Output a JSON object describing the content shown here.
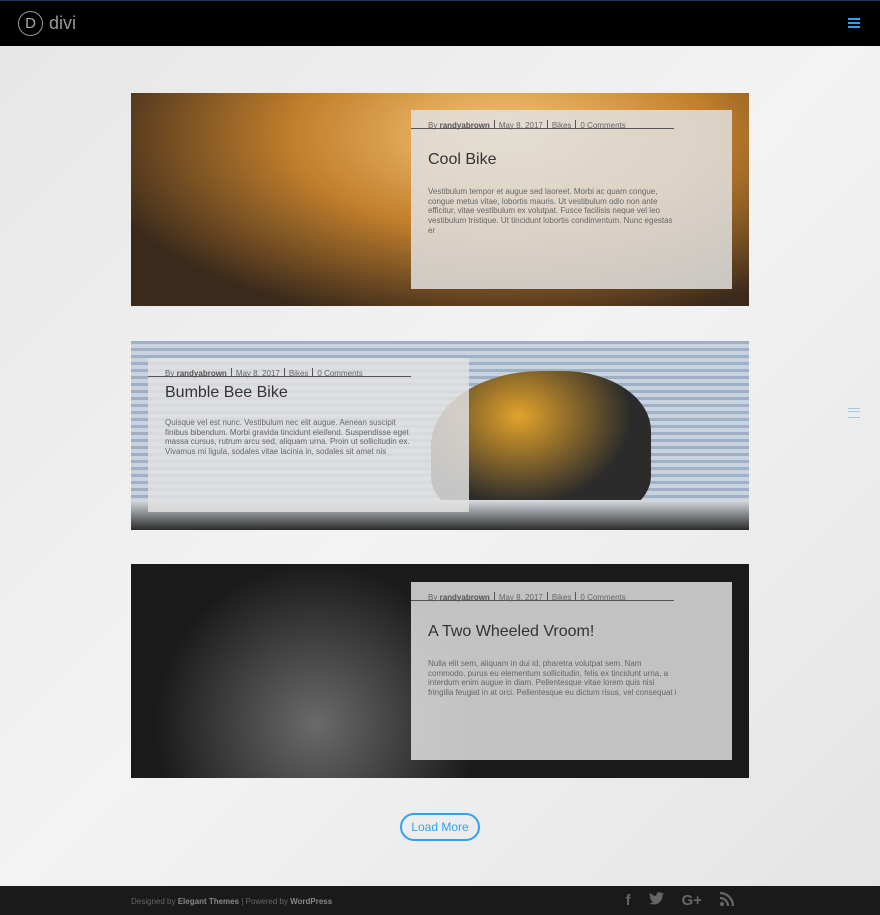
{
  "header": {
    "logo_letter": "D",
    "logo_text": "divi"
  },
  "posts": [
    {
      "by": "By",
      "author": "randyabrown",
      "date": "May 8, 2017",
      "category": "Bikes",
      "comments": "0 Comments",
      "title": "Cool Bike",
      "excerpt": "Vestibulum tempor et augue sed laoreet. Morbi ac quam congue, congue metus vitae, lobortis mauris. Ut vestibulum odio non ante efficitur, vitae vestibulum ex volutpat. Fusce facilisis neque vel leo vestibulum tristique. Ut tincidunt lobortis condimentum. Nunc egestas er"
    },
    {
      "by": "By",
      "author": "randyabrown",
      "date": "May 8, 2017",
      "category": "Bikes",
      "comments": "0 Comments",
      "title": "Bumble Bee Bike",
      "excerpt": "Quisque vel est nunc. Vestibulum nec elit augue. Aenean suscipit finibus bibendum. Morbi gravida tincidunt eleifend. Suspendisse eget massa cursus, rutrum arcu sed, aliquam urna. Proin ut sollicitudin ex. Vivamus mi ligula, sodales vitae lacinia in, sodales sit amet nis"
    },
    {
      "by": "By",
      "author": "randyabrown",
      "date": "May 8, 2017",
      "category": "Bikes",
      "comments": "0 Comments",
      "title": "A Two Wheeled Vroom!",
      "excerpt": "Nulla elit sem, aliquam in dui id, pharetra volutpat sem. Nam commodo, purus eu elementum sollicitudin, felis ex tincidunt urna, a interdum enim augue in diam. Pellentesque vitae lorem quis nisi fringilla feugiat in at orci. Pellentesque eu dictum risus, vel consequat i"
    }
  ],
  "load_more": "Load More",
  "footer": {
    "designed_by": "Designed by",
    "elegant": "Elegant Themes",
    "powered_by": "| Powered by",
    "wordpress": "WordPress",
    "social": {
      "facebook": "f",
      "twitter": "🐦",
      "google": "G+",
      "rss": "RSS"
    }
  },
  "colors": {
    "accent": "#2ea3f2",
    "footer_bg": "#1a1a1a",
    "header_bg": "#000000"
  }
}
